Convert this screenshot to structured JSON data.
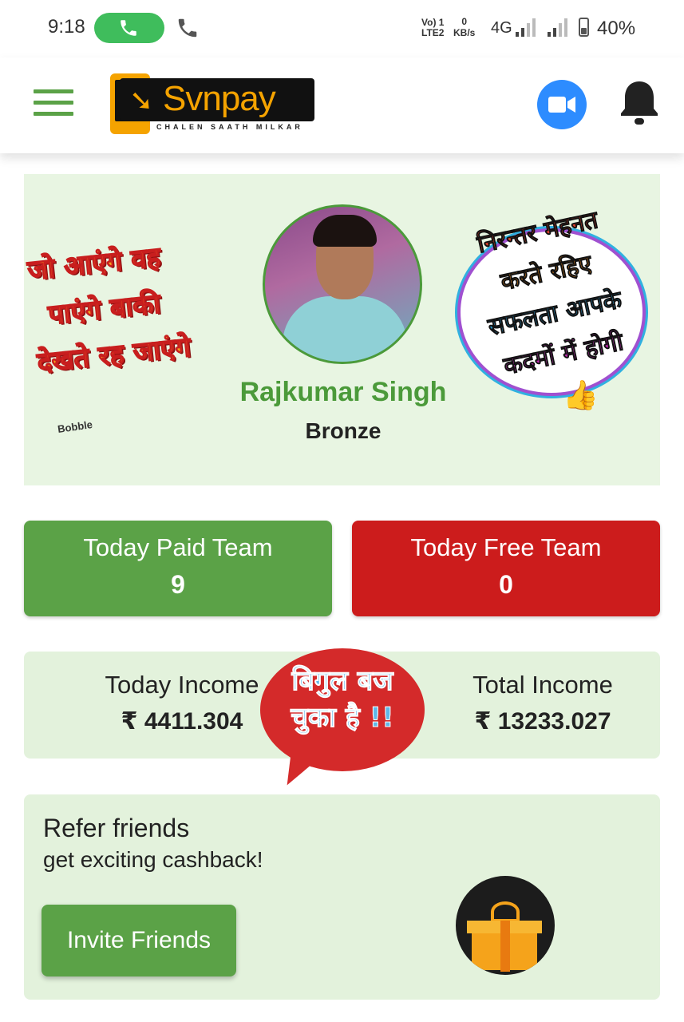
{
  "status_bar": {
    "time": "9:18",
    "volte_line1": "Vo) 1",
    "volte_line2": "LTE2",
    "speed_value": "0",
    "speed_unit": "KB/s",
    "network": "4G",
    "battery": "40%"
  },
  "header": {
    "logo_text": "Svnpay",
    "logo_tagline": "CHALEN SAATH MILKAR"
  },
  "profile": {
    "name": "Rajkumar Singh",
    "rank": "Bronze",
    "sticker_left": [
      "जो आएंगे वह",
      "पाएंगे बाकी",
      "देखते रह जाएंगे"
    ],
    "sticker_left_brand": "Bobble",
    "sticker_right": [
      "निरन्तर मेहनत",
      "करते रहिए",
      "सफलता आपके",
      "कदमों में होगी"
    ]
  },
  "team": {
    "paid_label": "Today Paid Team",
    "paid_value": "9",
    "free_label": "Today Free Team",
    "free_value": "0"
  },
  "income": {
    "today_label": "Today Income",
    "today_value": "₹ 4411.304",
    "total_label": "Total Income",
    "total_value": "₹ 13233.027",
    "sticker_line1": "बिगुल बज",
    "sticker_line2": "चुका है !!"
  },
  "refer": {
    "title": "Refer friends",
    "subtitle": "get exciting cashback!",
    "button_label": "Invite Friends"
  },
  "colors": {
    "brand_green": "#5ba247",
    "alert_red": "#cc1c1c",
    "card_bg": "#e3f2dc",
    "video_blue": "#2d8cff",
    "logo_orange": "#f5a300"
  }
}
